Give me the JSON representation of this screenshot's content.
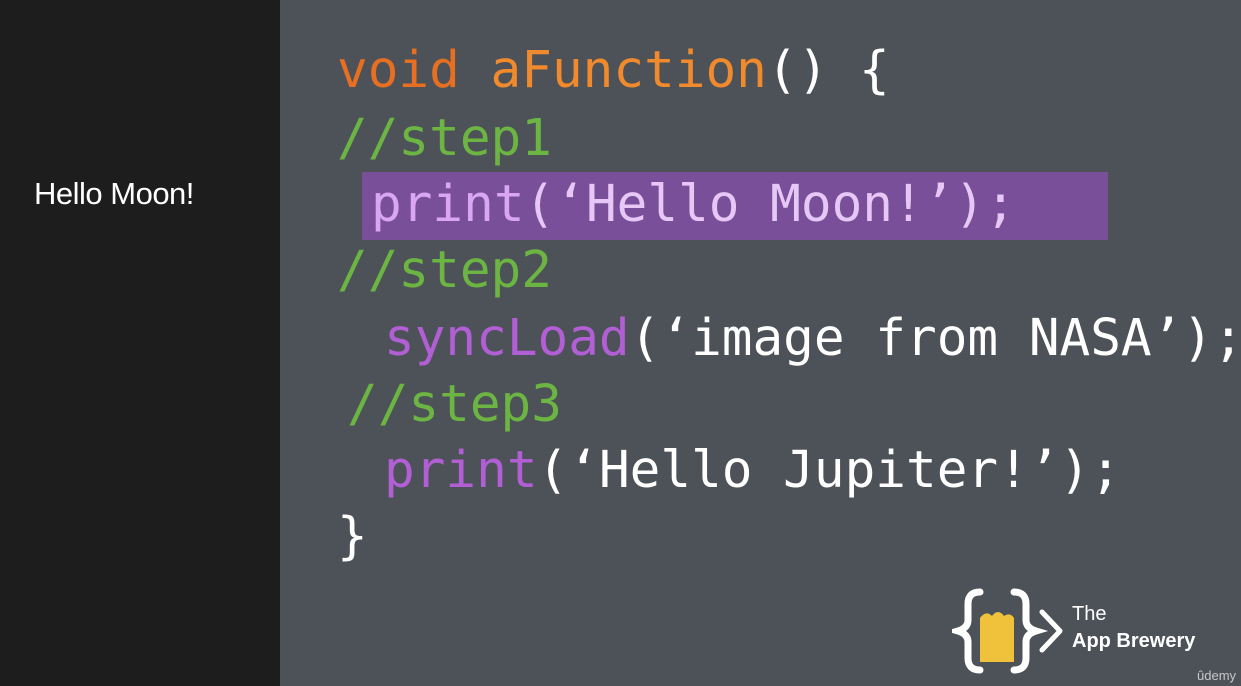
{
  "console": {
    "output": "Hello Moon!"
  },
  "code": {
    "line1": {
      "kw": "void",
      "fn": "aFunction",
      "rest": "() {"
    },
    "line2": "//step1",
    "line3": {
      "call": "print",
      "open": "(",
      "str": "‘Hello Moon!’",
      "close": ");"
    },
    "line4": "//step2",
    "line5": {
      "call": "syncLoad",
      "open": "(",
      "str": "‘image from NASA’",
      "close": ");"
    },
    "line6": "//step3",
    "line7": {
      "call": "print",
      "open": "(",
      "str": "‘Hello Jupiter!’",
      "close": ");"
    },
    "line8": "}"
  },
  "brand": {
    "line1": "The",
    "line2": "App Brewery",
    "watermark": "ûdemy"
  },
  "colors": {
    "keyword": "#e66f22",
    "function_name": "#f08a2c",
    "comment": "#6cb543",
    "call": "#b25fd6",
    "highlight_bg": "#7a4f9a",
    "editor_bg": "#4d5259",
    "console_bg": "#1d1d1e"
  }
}
